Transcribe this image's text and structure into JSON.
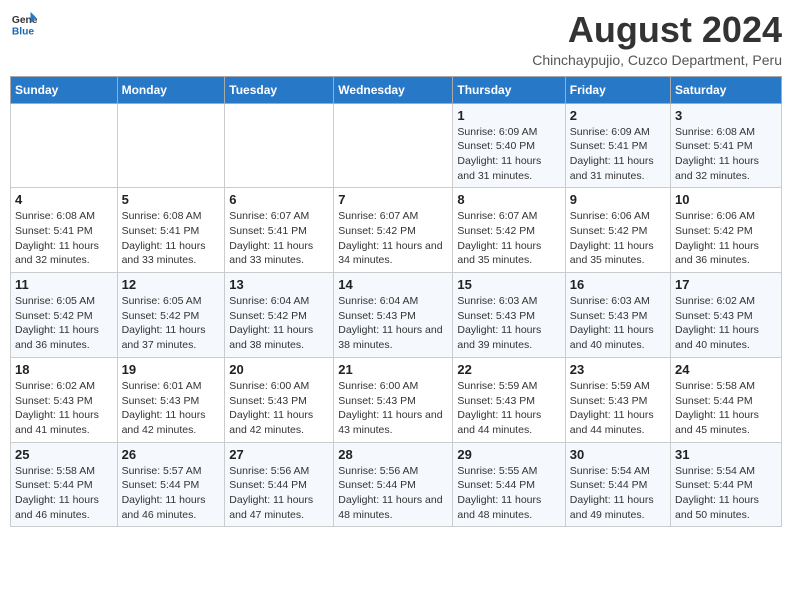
{
  "header": {
    "logo_general": "General",
    "logo_blue": "Blue",
    "title": "August 2024",
    "subtitle": "Chinchaypujio, Cuzco Department, Peru"
  },
  "weekdays": [
    "Sunday",
    "Monday",
    "Tuesday",
    "Wednesday",
    "Thursday",
    "Friday",
    "Saturday"
  ],
  "weeks": [
    [
      {
        "day": "",
        "info": ""
      },
      {
        "day": "",
        "info": ""
      },
      {
        "day": "",
        "info": ""
      },
      {
        "day": "",
        "info": ""
      },
      {
        "day": "1",
        "sunrise": "6:09 AM",
        "sunset": "5:40 PM",
        "daylight": "11 hours and 31 minutes."
      },
      {
        "day": "2",
        "sunrise": "6:09 AM",
        "sunset": "5:41 PM",
        "daylight": "11 hours and 31 minutes."
      },
      {
        "day": "3",
        "sunrise": "6:08 AM",
        "sunset": "5:41 PM",
        "daylight": "11 hours and 32 minutes."
      }
    ],
    [
      {
        "day": "4",
        "sunrise": "6:08 AM",
        "sunset": "5:41 PM",
        "daylight": "11 hours and 32 minutes."
      },
      {
        "day": "5",
        "sunrise": "6:08 AM",
        "sunset": "5:41 PM",
        "daylight": "11 hours and 33 minutes."
      },
      {
        "day": "6",
        "sunrise": "6:07 AM",
        "sunset": "5:41 PM",
        "daylight": "11 hours and 33 minutes."
      },
      {
        "day": "7",
        "sunrise": "6:07 AM",
        "sunset": "5:42 PM",
        "daylight": "11 hours and 34 minutes."
      },
      {
        "day": "8",
        "sunrise": "6:07 AM",
        "sunset": "5:42 PM",
        "daylight": "11 hours and 35 minutes."
      },
      {
        "day": "9",
        "sunrise": "6:06 AM",
        "sunset": "5:42 PM",
        "daylight": "11 hours and 35 minutes."
      },
      {
        "day": "10",
        "sunrise": "6:06 AM",
        "sunset": "5:42 PM",
        "daylight": "11 hours and 36 minutes."
      }
    ],
    [
      {
        "day": "11",
        "sunrise": "6:05 AM",
        "sunset": "5:42 PM",
        "daylight": "11 hours and 36 minutes."
      },
      {
        "day": "12",
        "sunrise": "6:05 AM",
        "sunset": "5:42 PM",
        "daylight": "11 hours and 37 minutes."
      },
      {
        "day": "13",
        "sunrise": "6:04 AM",
        "sunset": "5:42 PM",
        "daylight": "11 hours and 38 minutes."
      },
      {
        "day": "14",
        "sunrise": "6:04 AM",
        "sunset": "5:43 PM",
        "daylight": "11 hours and 38 minutes."
      },
      {
        "day": "15",
        "sunrise": "6:03 AM",
        "sunset": "5:43 PM",
        "daylight": "11 hours and 39 minutes."
      },
      {
        "day": "16",
        "sunrise": "6:03 AM",
        "sunset": "5:43 PM",
        "daylight": "11 hours and 40 minutes."
      },
      {
        "day": "17",
        "sunrise": "6:02 AM",
        "sunset": "5:43 PM",
        "daylight": "11 hours and 40 minutes."
      }
    ],
    [
      {
        "day": "18",
        "sunrise": "6:02 AM",
        "sunset": "5:43 PM",
        "daylight": "11 hours and 41 minutes."
      },
      {
        "day": "19",
        "sunrise": "6:01 AM",
        "sunset": "5:43 PM",
        "daylight": "11 hours and 42 minutes."
      },
      {
        "day": "20",
        "sunrise": "6:00 AM",
        "sunset": "5:43 PM",
        "daylight": "11 hours and 42 minutes."
      },
      {
        "day": "21",
        "sunrise": "6:00 AM",
        "sunset": "5:43 PM",
        "daylight": "11 hours and 43 minutes."
      },
      {
        "day": "22",
        "sunrise": "5:59 AM",
        "sunset": "5:43 PM",
        "daylight": "11 hours and 44 minutes."
      },
      {
        "day": "23",
        "sunrise": "5:59 AM",
        "sunset": "5:43 PM",
        "daylight": "11 hours and 44 minutes."
      },
      {
        "day": "24",
        "sunrise": "5:58 AM",
        "sunset": "5:44 PM",
        "daylight": "11 hours and 45 minutes."
      }
    ],
    [
      {
        "day": "25",
        "sunrise": "5:58 AM",
        "sunset": "5:44 PM",
        "daylight": "11 hours and 46 minutes."
      },
      {
        "day": "26",
        "sunrise": "5:57 AM",
        "sunset": "5:44 PM",
        "daylight": "11 hours and 46 minutes."
      },
      {
        "day": "27",
        "sunrise": "5:56 AM",
        "sunset": "5:44 PM",
        "daylight": "11 hours and 47 minutes."
      },
      {
        "day": "28",
        "sunrise": "5:56 AM",
        "sunset": "5:44 PM",
        "daylight": "11 hours and 48 minutes."
      },
      {
        "day": "29",
        "sunrise": "5:55 AM",
        "sunset": "5:44 PM",
        "daylight": "11 hours and 48 minutes."
      },
      {
        "day": "30",
        "sunrise": "5:54 AM",
        "sunset": "5:44 PM",
        "daylight": "11 hours and 49 minutes."
      },
      {
        "day": "31",
        "sunrise": "5:54 AM",
        "sunset": "5:44 PM",
        "daylight": "11 hours and 50 minutes."
      }
    ]
  ]
}
